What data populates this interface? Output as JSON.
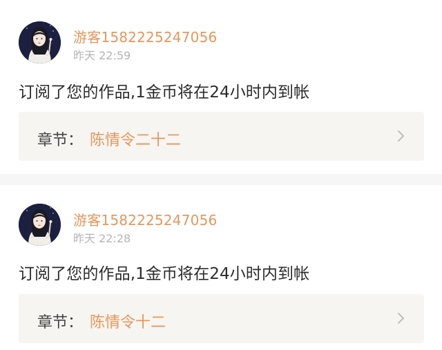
{
  "notifications": [
    {
      "username": "游客1582225247056",
      "time": "昨天 22:59",
      "message": "订阅了您的作品,1金币将在24小时内到帐",
      "chapter_label": "章节：",
      "chapter_title": "陈情令二十二"
    },
    {
      "username": "游客1582225247056",
      "time": "昨天 22:28",
      "message": "订阅了您的作品,1金币将在24小时内到帐",
      "chapter_label": "章节：",
      "chapter_title": "陈情令十二"
    }
  ],
  "colors": {
    "accent": "#e8965a",
    "time": "#b4b4b4",
    "text": "#2b2b2b",
    "chapter_bg": "#f6f5f1",
    "divider": "#f6f6f6"
  },
  "icons": {
    "avatar": "avatar-illustration",
    "chevron": "chevron-right-icon"
  }
}
